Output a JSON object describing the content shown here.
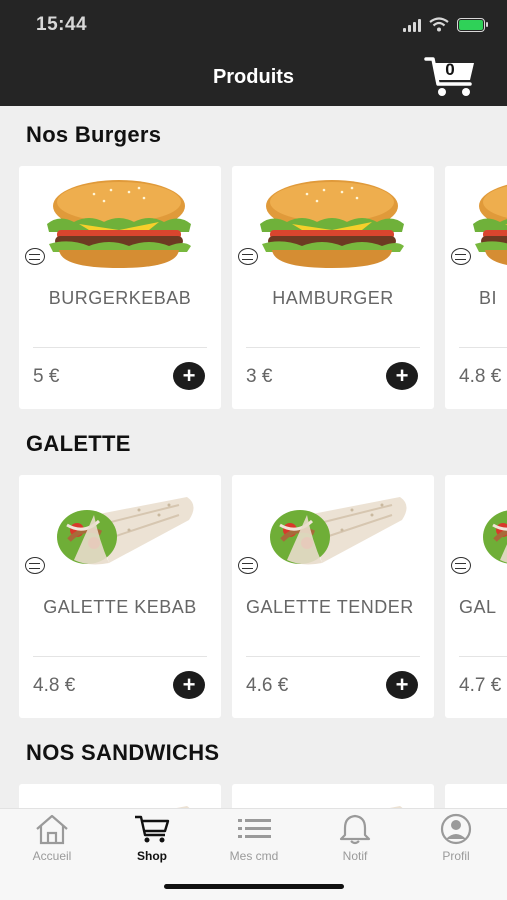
{
  "status_bar": {
    "time": "15:44"
  },
  "header": {
    "title": "Produits",
    "cart_count": "0"
  },
  "sections": [
    {
      "title": "Nos Burgers",
      "items": [
        {
          "name": "BURGERKEBAB",
          "price": "5 €",
          "image": "burger"
        },
        {
          "name": "HAMBURGER",
          "price": "3 €",
          "image": "burger"
        },
        {
          "name": "BI",
          "price": "4.8 €",
          "image": "burger"
        }
      ]
    },
    {
      "title": "GALETTE",
      "items": [
        {
          "name": "GALETTE KEBAB",
          "price": "4.8 €",
          "image": "wrap"
        },
        {
          "name": "GALETTE TENDER",
          "price": "4.6 €",
          "image": "wrap"
        },
        {
          "name": "GAL",
          "price": "4.7 €",
          "image": "wrap"
        }
      ]
    },
    {
      "title": "NOS SANDWICHS",
      "items": []
    }
  ],
  "add_button_label": "+",
  "bottom_nav": [
    {
      "label": "Accueil",
      "icon": "home-icon"
    },
    {
      "label": "Shop",
      "icon": "cart-icon",
      "active": true
    },
    {
      "label": "Mes cmd",
      "icon": "list-icon"
    },
    {
      "label": "Notif",
      "icon": "bell-icon"
    },
    {
      "label": "Profil",
      "icon": "profile-icon"
    }
  ],
  "colors": {
    "topbar": "#252525",
    "accent": "#1c1c1c",
    "battery": "#2fd158"
  }
}
